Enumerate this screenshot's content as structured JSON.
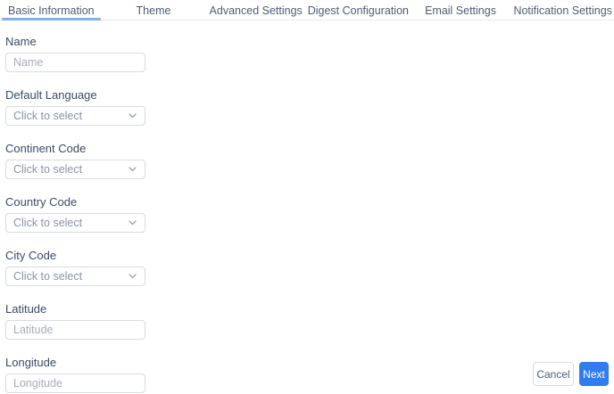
{
  "tabs": [
    {
      "label": "Basic Information",
      "active": true
    },
    {
      "label": "Theme",
      "active": false
    },
    {
      "label": "Advanced Settings",
      "active": false
    },
    {
      "label": "Digest Configuration",
      "active": false
    },
    {
      "label": "Email Settings",
      "active": false
    },
    {
      "label": "Notification Settings",
      "active": false
    }
  ],
  "form": {
    "fields": [
      {
        "label": "Name",
        "type": "text",
        "placeholder": "Name",
        "value": ""
      },
      {
        "label": "Default Language",
        "type": "select",
        "value": "Click to select"
      },
      {
        "label": "Continent Code",
        "type": "select",
        "value": "Click to select"
      },
      {
        "label": "Country Code",
        "type": "select",
        "value": "Click to select"
      },
      {
        "label": "City Code",
        "type": "select",
        "value": "Click to select"
      },
      {
        "label": "Latitude",
        "type": "text",
        "placeholder": "Latitude",
        "value": ""
      },
      {
        "label": "Longitude",
        "type": "text",
        "placeholder": "Longitude",
        "value": ""
      }
    ]
  },
  "footer": {
    "cancel_label": "Cancel",
    "next_label": "Next"
  },
  "icons": {
    "select_chevron": "chevron-down-icon"
  },
  "colors": {
    "accent_blue": "#2f7df0",
    "active_tab_underline": "#85aeec",
    "border_gray": "#d8dbe0",
    "label_text": "#3c4b64",
    "muted_text": "#8a93a2",
    "placeholder_text": "#a5adba"
  }
}
